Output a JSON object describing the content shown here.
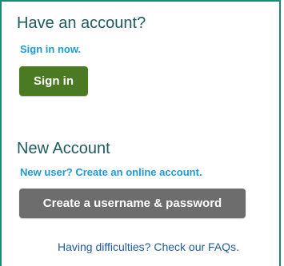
{
  "have_account": {
    "heading": "Have an account?",
    "sign_in_link": "Sign in now.",
    "sign_in_button": "Sign in"
  },
  "new_account": {
    "heading": "New Account",
    "create_link": "New user? Create an online account.",
    "create_button": "Create a username & password"
  },
  "help": {
    "faq_link": "Having difficulties? Check our FAQs."
  },
  "colors": {
    "border": "#1b8a74",
    "heading": "#1f5a5e",
    "link": "#1e9ad6",
    "sign_in_button": "#4a7a22",
    "create_button": "#6d6d6d",
    "faq_link": "#1f5a9e"
  }
}
